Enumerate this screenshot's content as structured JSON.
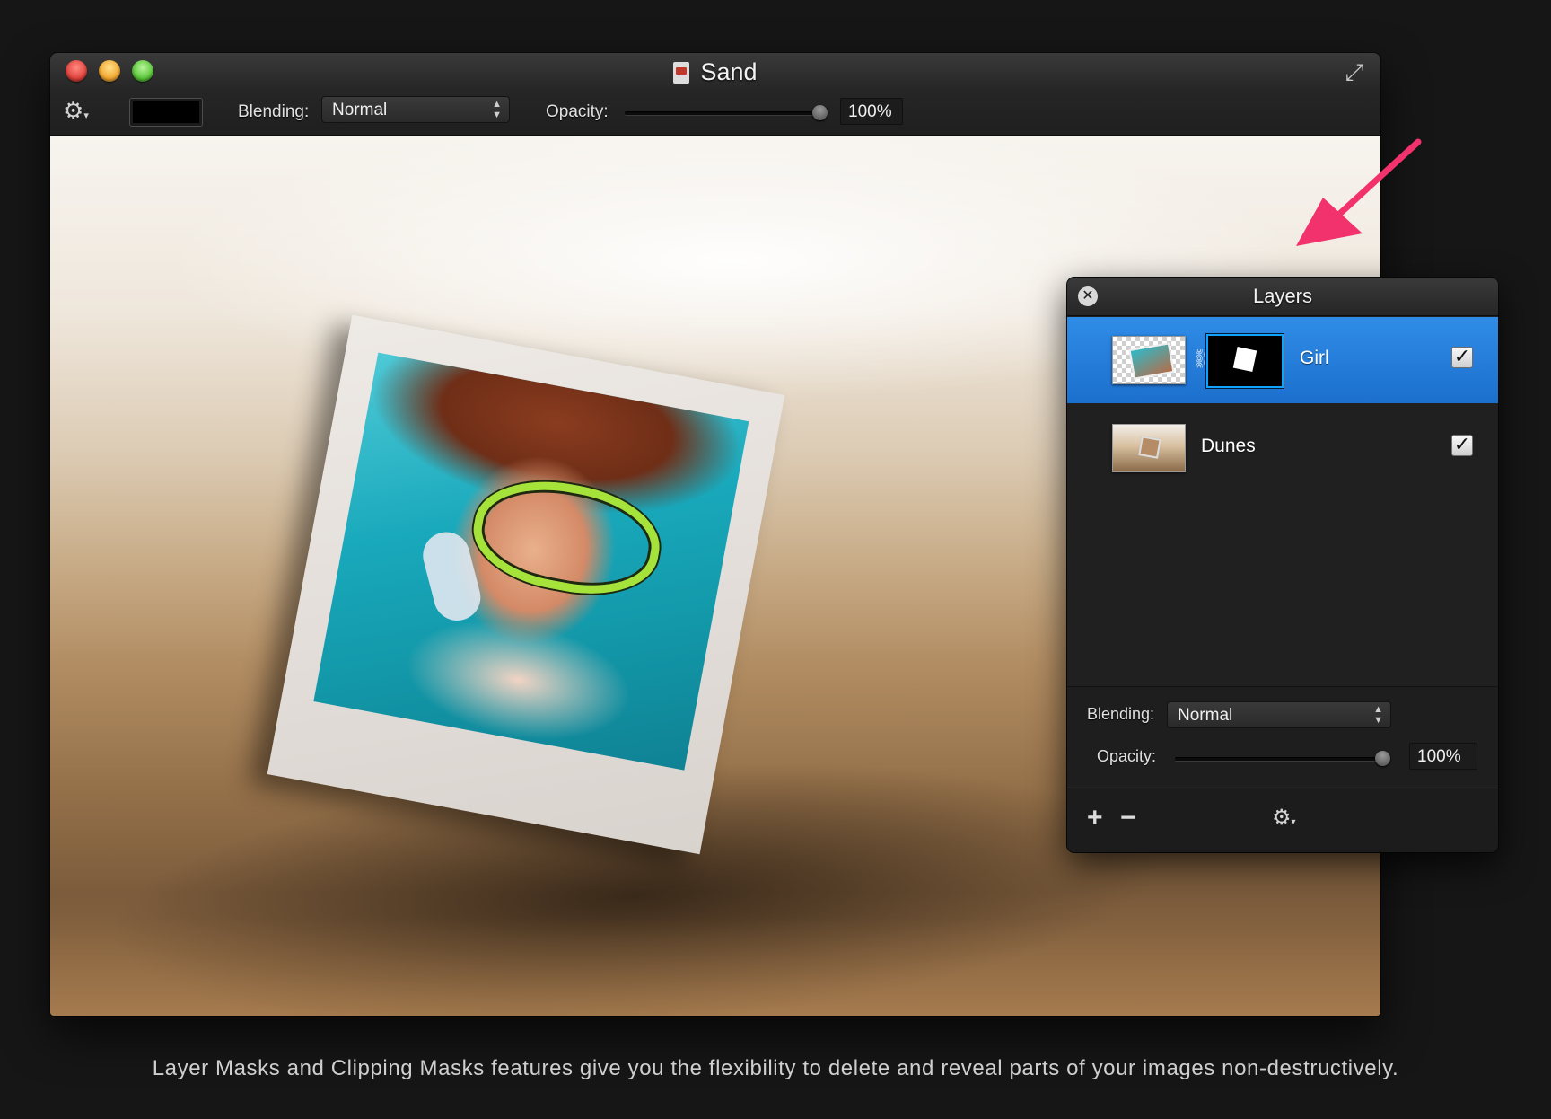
{
  "window": {
    "title": "Sand",
    "toolbar": {
      "blending_label": "Blending:",
      "blending_value": "Normal",
      "opacity_label": "Opacity:",
      "opacity_value": "100%",
      "opacity_fraction": 1.0
    }
  },
  "layers_panel": {
    "title": "Layers",
    "layers": [
      {
        "name": "Girl",
        "visible": true,
        "selected": true,
        "has_mask": true
      },
      {
        "name": "Dunes",
        "visible": true,
        "selected": false,
        "has_mask": false
      }
    ],
    "blending_label": "Blending:",
    "blending_value": "Normal",
    "opacity_label": "Opacity:",
    "opacity_value": "100%",
    "opacity_fraction": 1.0
  },
  "caption": "Layer Masks and Clipping Masks features give you the flexibility to delete and reveal parts of your images non-destructively.",
  "icons": {
    "close": "close-icon",
    "gear": "gear-icon",
    "fullscreen": "fullscreen-icon",
    "link": "link-icon",
    "add": "plus-icon",
    "remove": "minus-icon",
    "checkmark": "checkmark-icon"
  },
  "colors": {
    "selection": "#2a86e3",
    "arrow": "#f2326c",
    "close_red": "#e0443e",
    "minimize_yellow": "#f2a932",
    "zoom_green": "#5cc73b"
  }
}
